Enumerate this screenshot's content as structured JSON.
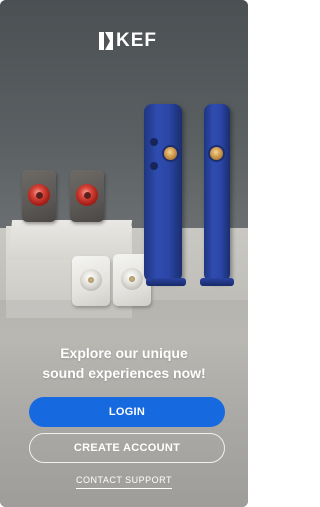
{
  "brand": {
    "logo_text": "KEF"
  },
  "hero": {
    "image": "kef-speakers-lifestyle"
  },
  "headline": {
    "line1": "Explore our unique",
    "line2": "sound experiences now!"
  },
  "actions": {
    "login_label": "LOGIN",
    "create_account_label": "CREATE ACCOUNT",
    "contact_support_label": "CONTACT SUPPORT"
  },
  "colors": {
    "primary_button": "#1769e0",
    "text": "#ffffff",
    "background": "#6a6f71"
  }
}
